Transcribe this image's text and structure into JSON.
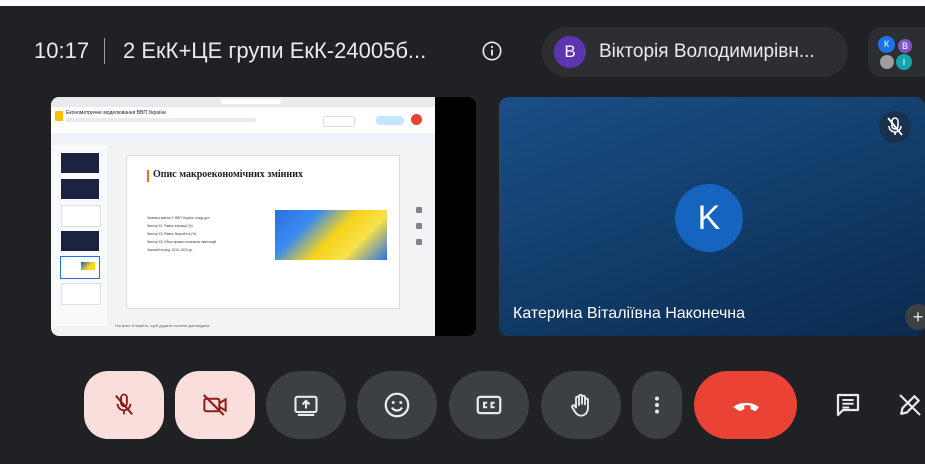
{
  "header": {
    "time": "10:17",
    "meeting_title": "2 ЕкК+ЦЕ групи ЕкК-24005б...",
    "active_speaker": {
      "initial": "В",
      "name": "Вікторія Володимирівн..."
    },
    "participants": [
      {
        "initial": "К",
        "color": "#1a73e8"
      },
      {
        "initial": "В",
        "color": "#7e57c2"
      },
      {
        "initial": "",
        "color": "#9e9e9e"
      },
      {
        "initial": "І",
        "color": "#12a4af"
      }
    ]
  },
  "shared_screen": {
    "app_title": "Економетричне моделювання ВВП України",
    "slide_title": "Опис макроекономічних змінних",
    "bullets": [
      "Залежна змінна Y: ВВП України, млрд дол",
      "Фактор X1: Рівень інфляції (%)",
      "Фактор X2: Рівень безробіття (%)",
      "Фактор X3: Обсяг прямих іноземних інвестицій",
      "Часовий період: 2010–2023 рр."
    ],
    "notes": "Нотатки: Клацніть, щоб додати нотатки доповідача"
  },
  "participant_tile": {
    "initial": "K",
    "name": "Катерина Віталіївна Наконечна"
  },
  "colors": {
    "background": "#202124",
    "control_bg": "#3c4043",
    "mic_off_bg": "#f9dedc",
    "end_call": "#ea4335",
    "tile_blue": "#1a4f86"
  },
  "controls": [
    {
      "name": "microphone-off",
      "icon": "mic-off-icon"
    },
    {
      "name": "camera-off",
      "icon": "videocam-off-icon"
    },
    {
      "name": "present-now",
      "icon": "present-icon"
    },
    {
      "name": "reactions",
      "icon": "emoji-icon"
    },
    {
      "name": "captions",
      "icon": "cc-icon"
    },
    {
      "name": "raise-hand",
      "icon": "hand-icon"
    },
    {
      "name": "more-options",
      "icon": "more-vert-icon"
    },
    {
      "name": "leave-call",
      "icon": "call-end-icon"
    },
    {
      "name": "chat",
      "icon": "chat-icon"
    },
    {
      "name": "activities",
      "icon": "pencil-icon"
    }
  ]
}
